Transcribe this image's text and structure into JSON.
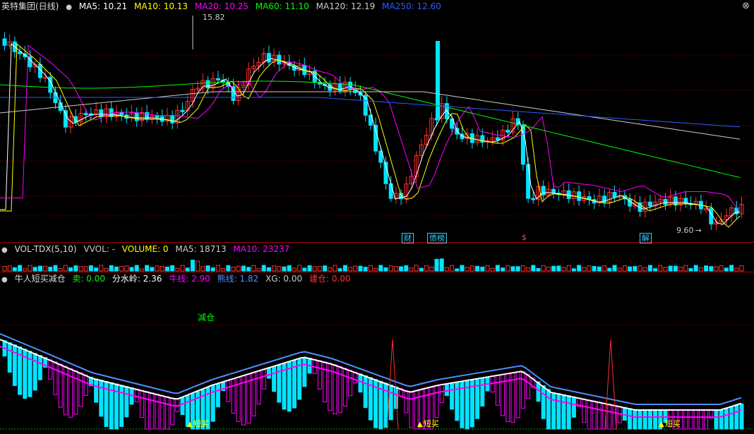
{
  "main": {
    "title": "英特集团(日线)",
    "ma": [
      {
        "label": "MA5: 10.21",
        "color": "#ffffff"
      },
      {
        "label": "MA10: 10.13",
        "color": "#ffff00"
      },
      {
        "label": "MA20: 10.25",
        "color": "#ff00ff"
      },
      {
        "label": "MA60: 11.10",
        "color": "#00ff00"
      },
      {
        "label": "MA120: 12.19",
        "color": "#cccccc"
      },
      {
        "label": "MA250: 12.60",
        "color": "#2b5bff"
      }
    ],
    "high_label": "15.82",
    "low_label": "9.60",
    "markers": [
      {
        "text": "财",
        "color": "#3cf"
      },
      {
        "text": "债榜",
        "color": "#3cf"
      },
      {
        "text": "$",
        "color": "#f44"
      },
      {
        "text": "解",
        "color": "#3cf"
      }
    ]
  },
  "volume": {
    "title": "VOL-TDX(5,10)",
    "items": [
      {
        "label": "VVOL: -",
        "color": "#cccccc"
      },
      {
        "label": "VOLUME: 0",
        "color": "#ffff00"
      },
      {
        "label": "MA5: 18713",
        "color": "#cccccc"
      },
      {
        "label": "MA10: 23237",
        "color": "#ff00ff"
      }
    ]
  },
  "indicator": {
    "title": "牛人短买减仓",
    "items": [
      {
        "label": "卖: 0.00",
        "color": "#00ff00"
      },
      {
        "label": "分水岭: 2.36",
        "color": "#ffffff"
      },
      {
        "label": "牛线: 2.90",
        "color": "#ff00ff"
      },
      {
        "label": "熊线: 1.82",
        "color": "#4f8fff"
      },
      {
        "label": "XG: 0.00",
        "color": "#cccccc"
      },
      {
        "label": "建仓: 0.00",
        "color": "#ff3030"
      }
    ],
    "reduce_label": "减仓",
    "short_buy_label": "短买"
  },
  "colors": {
    "up": "#ff3030",
    "down": "#00e5ff",
    "grid": "#a00000"
  },
  "icons": {
    "panel_dot": "dot-icon",
    "close": "close-icon"
  }
}
